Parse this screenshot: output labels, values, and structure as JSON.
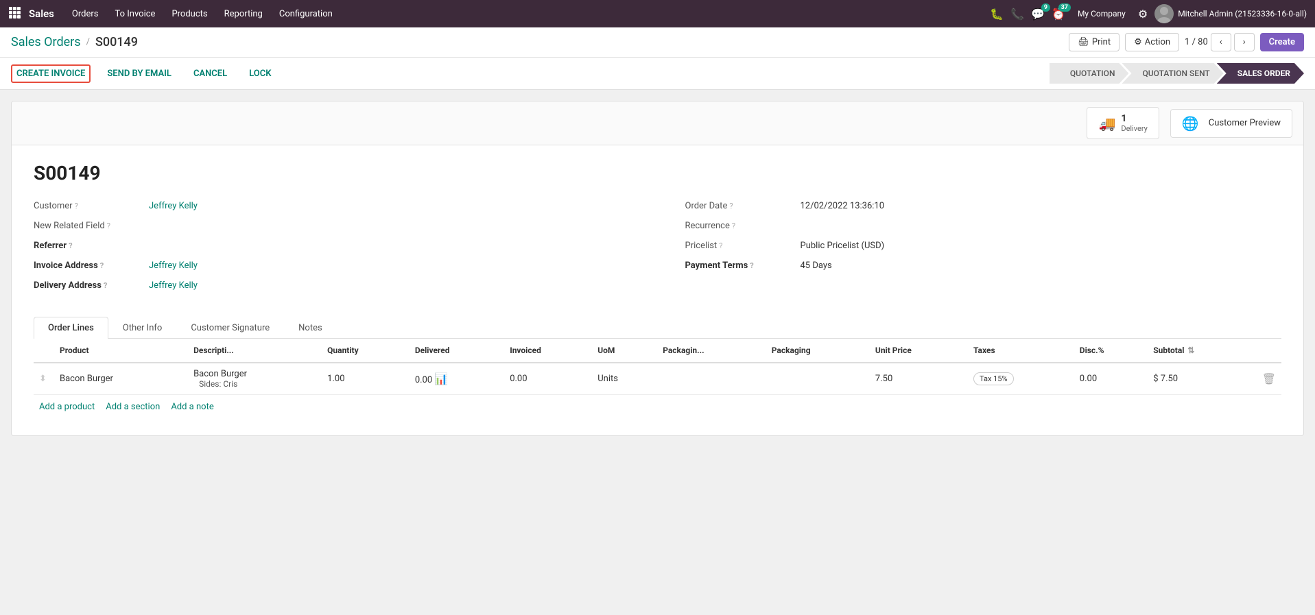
{
  "topbar": {
    "app_name": "Sales",
    "nav_items": [
      "Orders",
      "To Invoice",
      "Products",
      "Reporting",
      "Configuration"
    ],
    "badge_chat": "9",
    "badge_clock": "37",
    "company": "My Company",
    "user": "Mitchell Admin (21523336-16-0-all)"
  },
  "header": {
    "breadcrumb_parent": "Sales Orders",
    "breadcrumb_current": "S00149",
    "print_label": "Print",
    "action_label": "Action",
    "record_position": "1 / 80",
    "create_label": "Create"
  },
  "action_bar": {
    "create_invoice": "CREATE INVOICE",
    "send_by_email": "SEND BY EMAIL",
    "cancel": "CANCEL",
    "lock": "LOCK"
  },
  "status_pipeline": [
    {
      "label": "QUOTATION",
      "active": false
    },
    {
      "label": "QUOTATION SENT",
      "active": false
    },
    {
      "label": "SALES ORDER",
      "active": true
    }
  ],
  "smart_buttons": {
    "delivery_count": "1",
    "delivery_label": "Delivery",
    "customer_preview_label": "Customer Preview"
  },
  "form": {
    "order_number": "S00149",
    "customer_label": "Customer",
    "customer_value": "Jeffrey Kelly",
    "new_related_field_label": "New Related Field",
    "referrer_label": "Referrer",
    "invoice_address_label": "Invoice Address",
    "invoice_address_value": "Jeffrey Kelly",
    "delivery_address_label": "Delivery Address",
    "delivery_address_value": "Jeffrey Kelly",
    "order_date_label": "Order Date",
    "order_date_value": "12/02/2022 13:36:10",
    "recurrence_label": "Recurrence",
    "recurrence_value": "",
    "pricelist_label": "Pricelist",
    "pricelist_value": "Public Pricelist (USD)",
    "payment_terms_label": "Payment Terms",
    "payment_terms_value": "45 Days"
  },
  "tabs": [
    {
      "label": "Order Lines",
      "active": true
    },
    {
      "label": "Other Info",
      "active": false
    },
    {
      "label": "Customer Signature",
      "active": false
    },
    {
      "label": "Notes",
      "active": false
    }
  ],
  "table": {
    "columns": [
      "Product",
      "Descripti...",
      "Quantity",
      "Delivered",
      "Invoiced",
      "UoM",
      "Packagin...",
      "Packaging",
      "Unit Price",
      "Taxes",
      "Disc.%",
      "Subtotal"
    ],
    "rows": [
      {
        "product": "Bacon Burger",
        "description": "Bacon Burger",
        "quantity": "1.00",
        "delivered": "0.00",
        "invoiced": "0.00",
        "uom": "Units",
        "packaging_qty": "",
        "packaging": "",
        "unit_price": "7.50",
        "taxes": "Tax 15%",
        "disc": "0.00",
        "subtotal": "$ 7.50",
        "sub_description": "Sides: Cris"
      }
    ],
    "add_product": "Add a product",
    "add_section": "Add a section",
    "add_note": "Add a note"
  }
}
